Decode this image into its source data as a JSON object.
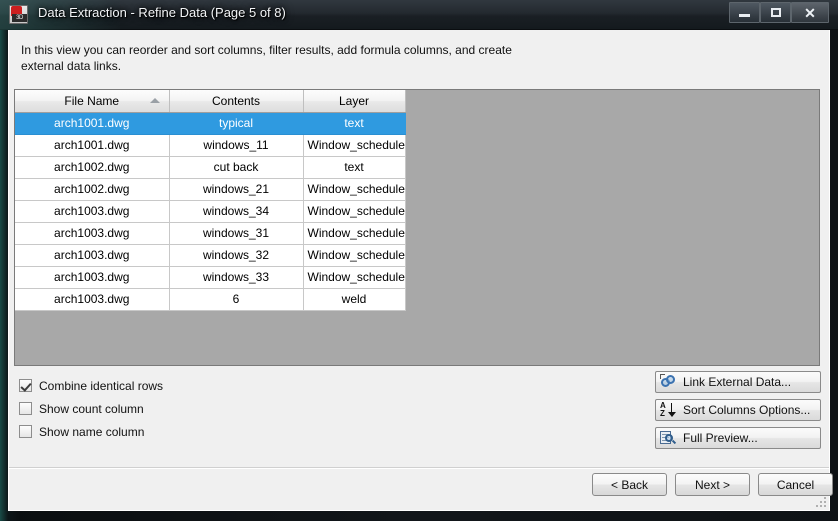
{
  "window": {
    "title": "Data Extraction - Refine Data (Page 5 of 8)",
    "icon_name": "autocad-3d-icon",
    "icon_label": "3D",
    "controls": {
      "minimize": "minimize-icon",
      "maximize": "maximize-icon",
      "close": "close-icon",
      "close_glyph": "✕"
    }
  },
  "description": "In this view you can reorder and sort columns, filter results, add formula columns, and create external data links.",
  "grid": {
    "columns": [
      {
        "label": "File Name",
        "sorted": "ascending"
      },
      {
        "label": "Contents",
        "sorted": ""
      },
      {
        "label": "Layer",
        "sorted": ""
      }
    ],
    "rows": [
      {
        "file": "arch1001.dwg",
        "contents": "typical",
        "layer": "text",
        "selected": true
      },
      {
        "file": "arch1001.dwg",
        "contents": "windows_11",
        "layer": "Window_schedule",
        "selected": false
      },
      {
        "file": "arch1002.dwg",
        "contents": "cut back",
        "layer": "text",
        "selected": false
      },
      {
        "file": "arch1002.dwg",
        "contents": "windows_21",
        "layer": "Window_schedule",
        "selected": false
      },
      {
        "file": "arch1003.dwg",
        "contents": "windows_34",
        "layer": "Window_schedule",
        "selected": false
      },
      {
        "file": "arch1003.dwg",
        "contents": "windows_31",
        "layer": "Window_schedule",
        "selected": false
      },
      {
        "file": "arch1003.dwg",
        "contents": "windows_32",
        "layer": "Window_schedule",
        "selected": false
      },
      {
        "file": "arch1003.dwg",
        "contents": "windows_33",
        "layer": "Window_schedule",
        "selected": false
      },
      {
        "file": "arch1003.dwg",
        "contents": "6",
        "layer": "weld",
        "selected": false
      }
    ]
  },
  "options": [
    {
      "label": "Combine identical rows",
      "checked": true
    },
    {
      "label": "Show count column",
      "checked": false
    },
    {
      "label": "Show name column",
      "checked": false
    }
  ],
  "actions": [
    {
      "label": "Link External Data...",
      "icon": "link-icon"
    },
    {
      "label": "Sort Columns Options...",
      "icon": "sort-az-icon"
    },
    {
      "label": "Full Preview...",
      "icon": "preview-magnifier-icon"
    }
  ],
  "navigation": [
    {
      "label": "< Back"
    },
    {
      "label": "Next >"
    },
    {
      "label": "Cancel"
    }
  ],
  "colors": {
    "selection": "#2f9ae0",
    "grid_background": "#a8a8a8",
    "dialog_background": "#f0f0f0"
  }
}
